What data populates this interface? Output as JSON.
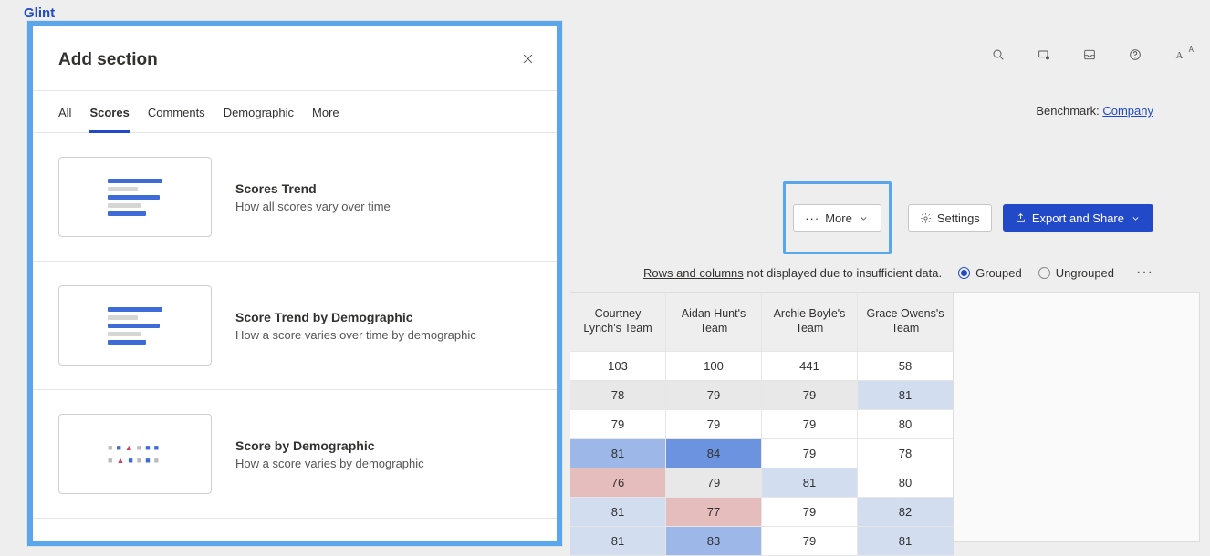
{
  "brand": "Glint",
  "benchmark": {
    "label": "Benchmark:",
    "link": "Company"
  },
  "actions": {
    "more": "More",
    "settings": "Settings",
    "export": "Export and Share"
  },
  "options_row": {
    "note_link": "Rows and columns",
    "note_rest": " not displayed due to insufficient data.",
    "grouped": "Grouped",
    "ungrouped": "Ungrouped"
  },
  "table": {
    "headers": [
      "Courtney Lynch's Team",
      "Aidan Hunt's Team",
      "Archie Boyle's Team",
      "Grace Owens's Team"
    ],
    "rows": [
      {
        "vals": [
          "103",
          "100",
          "441",
          "58"
        ],
        "cls": [
          "c-neu",
          "c-neu",
          "c-neu",
          "c-neu"
        ]
      },
      {
        "vals": [
          "78",
          "79",
          "79",
          "81"
        ],
        "cls": [
          "c-pale",
          "c-pale",
          "c-pale",
          "c-b1"
        ]
      },
      {
        "vals": [
          "79",
          "79",
          "79",
          "80"
        ],
        "cls": [
          "c-neu",
          "c-neu",
          "c-neu",
          "c-neu"
        ]
      },
      {
        "vals": [
          "81",
          "84",
          "79",
          "78"
        ],
        "cls": [
          "c-b2",
          "c-b3",
          "c-neu",
          "c-neu"
        ]
      },
      {
        "vals": [
          "76",
          "79",
          "81",
          "80"
        ],
        "cls": [
          "c-r2",
          "c-pale",
          "c-b1",
          "c-neu"
        ]
      },
      {
        "vals": [
          "81",
          "77",
          "79",
          "82"
        ],
        "cls": [
          "c-b1",
          "c-r2",
          "c-neu",
          "c-b1"
        ]
      },
      {
        "vals": [
          "81",
          "83",
          "79",
          "81"
        ],
        "cls": [
          "c-b1",
          "c-b2",
          "c-neu",
          "c-b1"
        ]
      }
    ]
  },
  "modal": {
    "title": "Add section",
    "tabs": [
      "All",
      "Scores",
      "Comments",
      "Demographic",
      "More"
    ],
    "active_tab": "Scores",
    "options": [
      {
        "title": "Scores Trend",
        "desc": "How all scores vary over time",
        "thumb": "bars"
      },
      {
        "title": "Score Trend by Demographic",
        "desc": "How a score varies over time by demographic",
        "thumb": "bars"
      },
      {
        "title": "Score by Demographic",
        "desc": "How a score varies by demographic",
        "thumb": "dots"
      }
    ]
  }
}
